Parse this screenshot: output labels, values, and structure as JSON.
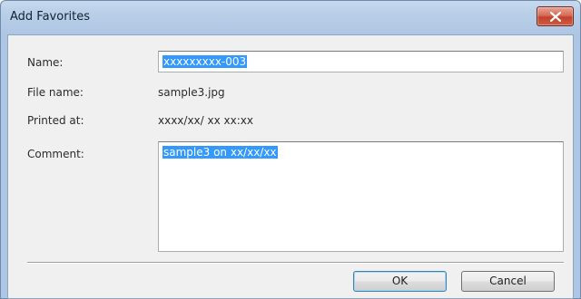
{
  "window": {
    "title": "Add Favorites",
    "close_icon": "close-icon"
  },
  "form": {
    "name_label": "Name:",
    "name_value": "xxxxxxxxx-003",
    "file_name_label": "File name:",
    "file_name_value": "sample3.jpg",
    "printed_at_label": "Printed at:",
    "printed_at_value": "xxxx/xx/ xx xx:xx",
    "comment_label": "Comment:",
    "comment_value": "sample3 on xx/xx/xx"
  },
  "buttons": {
    "ok_label": "OK",
    "cancel_label": "Cancel"
  },
  "colors": {
    "selection": "#3399ff",
    "close_button": "#c2412c",
    "title_bar": "#b9cfe8"
  }
}
